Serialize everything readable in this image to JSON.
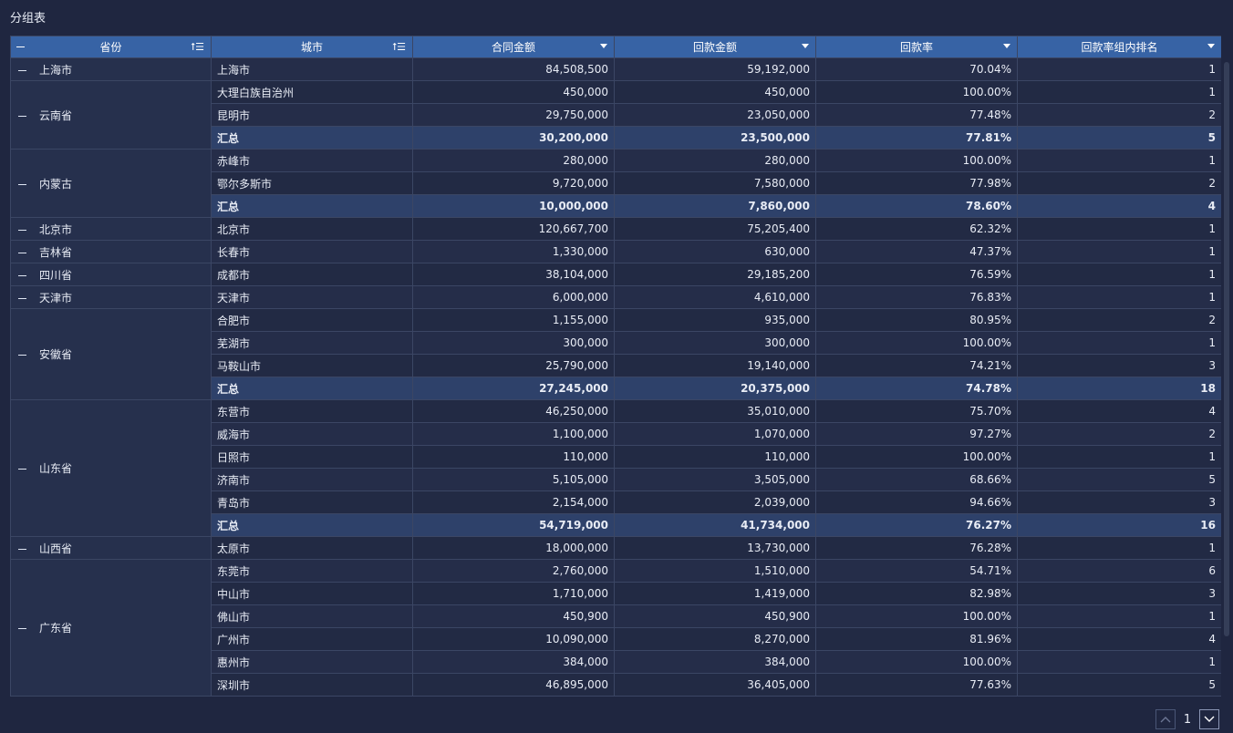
{
  "panel": {
    "title": "分组表"
  },
  "columns": {
    "province": "省份",
    "city": "城市",
    "contract": "合同金额",
    "payback": "回款金额",
    "rate": "回款率",
    "rank": "回款率组内排名"
  },
  "rows": [
    {
      "province": "上海市",
      "span": 1,
      "city": "上海市",
      "contract": "84,508,500",
      "payback": "59,192,000",
      "rate": "70.04%",
      "rank": "1"
    },
    {
      "province": "云南省",
      "span": 3,
      "city": "大理白族自治州",
      "contract": "450,000",
      "payback": "450,000",
      "rate": "100.00%",
      "rank": "1"
    },
    {
      "city": "昆明市",
      "contract": "29,750,000",
      "payback": "23,050,000",
      "rate": "77.48%",
      "rank": "2"
    },
    {
      "city": "汇总",
      "total": true,
      "contract": "30,200,000",
      "payback": "23,500,000",
      "rate": "77.81%",
      "rank": "5"
    },
    {
      "province": "内蒙古",
      "span": 3,
      "city": "赤峰市",
      "contract": "280,000",
      "payback": "280,000",
      "rate": "100.00%",
      "rank": "1"
    },
    {
      "city": "鄂尔多斯市",
      "contract": "9,720,000",
      "payback": "7,580,000",
      "rate": "77.98%",
      "rank": "2"
    },
    {
      "city": "汇总",
      "total": true,
      "contract": "10,000,000",
      "payback": "7,860,000",
      "rate": "78.60%",
      "rank": "4"
    },
    {
      "province": "北京市",
      "span": 1,
      "city": "北京市",
      "contract": "120,667,700",
      "payback": "75,205,400",
      "rate": "62.32%",
      "rank": "1"
    },
    {
      "province": "吉林省",
      "span": 1,
      "city": "长春市",
      "contract": "1,330,000",
      "payback": "630,000",
      "rate": "47.37%",
      "rank": "1"
    },
    {
      "province": "四川省",
      "span": 1,
      "city": "成都市",
      "contract": "38,104,000",
      "payback": "29,185,200",
      "rate": "76.59%",
      "rank": "1"
    },
    {
      "province": "天津市",
      "span": 1,
      "city": "天津市",
      "contract": "6,000,000",
      "payback": "4,610,000",
      "rate": "76.83%",
      "rank": "1"
    },
    {
      "province": "安徽省",
      "span": 4,
      "city": "合肥市",
      "contract": "1,155,000",
      "payback": "935,000",
      "rate": "80.95%",
      "rank": "2"
    },
    {
      "city": "芜湖市",
      "contract": "300,000",
      "payback": "300,000",
      "rate": "100.00%",
      "rank": "1"
    },
    {
      "city": "马鞍山市",
      "contract": "25,790,000",
      "payback": "19,140,000",
      "rate": "74.21%",
      "rank": "3"
    },
    {
      "city": "汇总",
      "total": true,
      "contract": "27,245,000",
      "payback": "20,375,000",
      "rate": "74.78%",
      "rank": "18"
    },
    {
      "province": "山东省",
      "span": 6,
      "city": "东营市",
      "contract": "46,250,000",
      "payback": "35,010,000",
      "rate": "75.70%",
      "rank": "4"
    },
    {
      "city": "威海市",
      "contract": "1,100,000",
      "payback": "1,070,000",
      "rate": "97.27%",
      "rank": "2"
    },
    {
      "city": "日照市",
      "contract": "110,000",
      "payback": "110,000",
      "rate": "100.00%",
      "rank": "1"
    },
    {
      "city": "济南市",
      "contract": "5,105,000",
      "payback": "3,505,000",
      "rate": "68.66%",
      "rank": "5"
    },
    {
      "city": "青岛市",
      "contract": "2,154,000",
      "payback": "2,039,000",
      "rate": "94.66%",
      "rank": "3"
    },
    {
      "city": "汇总",
      "total": true,
      "contract": "54,719,000",
      "payback": "41,734,000",
      "rate": "76.27%",
      "rank": "16"
    },
    {
      "province": "山西省",
      "span": 1,
      "city": "太原市",
      "contract": "18,000,000",
      "payback": "13,730,000",
      "rate": "76.28%",
      "rank": "1"
    },
    {
      "province": "广东省",
      "span": 7,
      "city": "东莞市",
      "contract": "2,760,000",
      "payback": "1,510,000",
      "rate": "54.71%",
      "rank": "6"
    },
    {
      "city": "中山市",
      "contract": "1,710,000",
      "payback": "1,419,000",
      "rate": "82.98%",
      "rank": "3"
    },
    {
      "city": "佛山市",
      "contract": "450,900",
      "payback": "450,900",
      "rate": "100.00%",
      "rank": "1"
    },
    {
      "city": "广州市",
      "contract": "10,090,000",
      "payback": "8,270,000",
      "rate": "81.96%",
      "rank": "4"
    },
    {
      "city": "惠州市",
      "contract": "384,000",
      "payback": "384,000",
      "rate": "100.00%",
      "rank": "1"
    },
    {
      "city": "深圳市",
      "contract": "46,895,000",
      "payback": "36,405,000",
      "rate": "77.63%",
      "rank": "5"
    }
  ],
  "pager": {
    "current": "1"
  }
}
